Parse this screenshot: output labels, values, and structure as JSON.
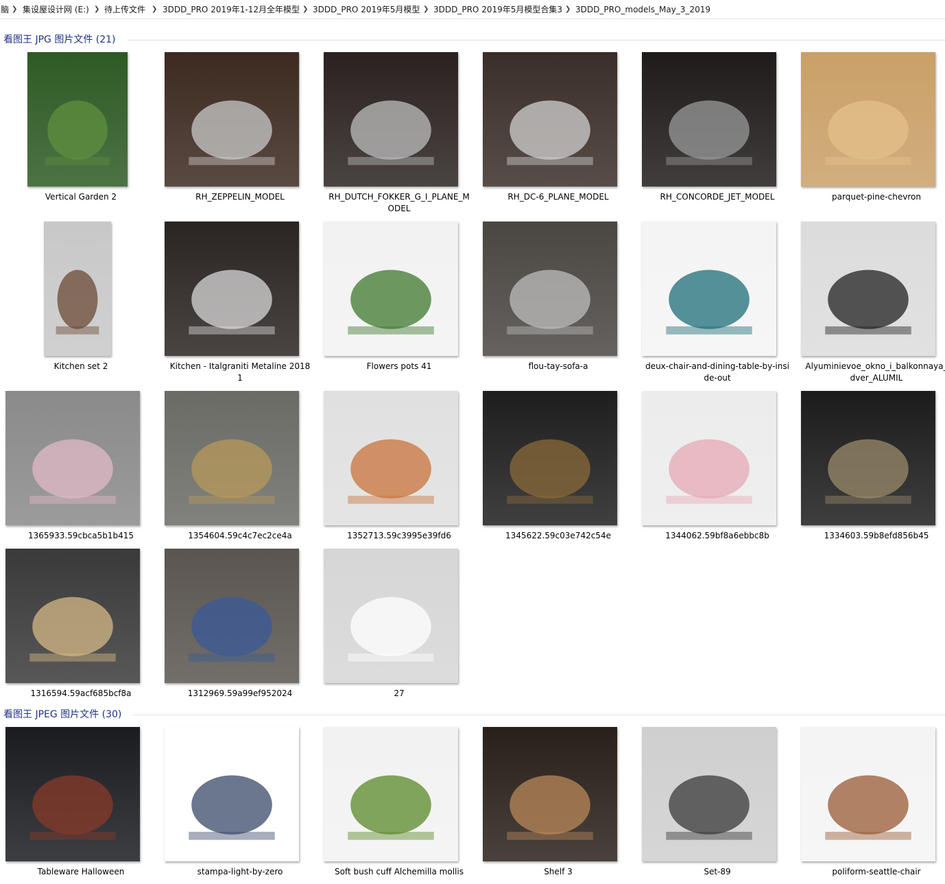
{
  "breadcrumb": [
    {
      "label": "脑"
    },
    {
      "label": "集设屋设计网 (E:)"
    },
    {
      "label": "待上传文件"
    },
    {
      "label": "3DDD_PRO 2019年1-12月全年模型"
    },
    {
      "label": "3DDD_PRO 2019年5月模型"
    },
    {
      "label": "3DDD_PRO 2019年5月模型合集3"
    },
    {
      "label": "3DDD_PRO_models_May_3_2019"
    }
  ],
  "groups": [
    {
      "title": "看图王 JPG 图片文件 (21)"
    },
    {
      "title": "看图王 JPEG 图片文件 (30)"
    }
  ],
  "files": [
    {
      "name": "Vertical Garden 2",
      "icon": "image-thumbnail-icon",
      "colors": [
        "#2e5a24",
        "#5f8f3f"
      ]
    },
    {
      "name": "RH_ZEPPELIN_MODEL",
      "icon": "image-thumbnail-icon",
      "colors": [
        "#3c2a20",
        "#c9c9c9"
      ]
    },
    {
      "name": "RH_DUTCH_FOKKER_G_I_PLANE_MODEL",
      "icon": "image-thumbnail-icon",
      "colors": [
        "#2a2220",
        "#bdbdbd"
      ]
    },
    {
      "name": "RH_DC-6_PLANE_MODEL",
      "icon": "image-thumbnail-icon",
      "colors": [
        "#3a2e28",
        "#d0d0d0"
      ]
    },
    {
      "name": "RH_CONCORDE_JET_MODEL",
      "icon": "image-thumbnail-icon",
      "colors": [
        "#1f1b1a",
        "#9a9a9a"
      ]
    },
    {
      "name": "parquet-pine-chevron",
      "icon": "image-thumbnail-icon",
      "colors": [
        "#c9a068",
        "#e3c08a"
      ]
    },
    {
      "name": "Kitchen set 2",
      "icon": "image-thumbnail-icon",
      "colors": [
        "#c8c8c8",
        "#6b4a35"
      ]
    },
    {
      "name": "Kitchen - Italgraniti Metaline 2018 1",
      "icon": "image-thumbnail-icon",
      "colors": [
        "#2a2422",
        "#d8d8d8"
      ]
    },
    {
      "name": "Flowers pots 41",
      "icon": "image-thumbnail-icon",
      "colors": [
        "#f2f2f2",
        "#3f7a2e"
      ]
    },
    {
      "name": "flou-tay-sofa-a",
      "icon": "image-thumbnail-icon",
      "colors": [
        "#4a4642",
        "#bdbdbd"
      ]
    },
    {
      "name": "deux-chair-and-dining-table-by-inside-out",
      "icon": "image-thumbnail-icon",
      "colors": [
        "#f4f4f4",
        "#1e6d78"
      ]
    },
    {
      "name": "Alyuminievoe_okno_i_balkonnaya_dver_ALUMIL",
      "icon": "image-thumbnail-icon",
      "colors": [
        "#dcdcdc",
        "#222222"
      ]
    },
    {
      "name": "1365933.59cbca5b1b415",
      "icon": "image-thumbnail-icon",
      "colors": [
        "#8a8a8a",
        "#e0b9c6"
      ]
    },
    {
      "name": "1354604.59c4c7ec2ce4a",
      "icon": "image-thumbnail-icon",
      "colors": [
        "#6b6b66",
        "#b89a5a"
      ]
    },
    {
      "name": "1352713.59c3995e39fd6",
      "icon": "image-thumbnail-icon",
      "colors": [
        "#e0e0e0",
        "#c9733a"
      ]
    },
    {
      "name": "1345622.59c03e742c54e",
      "icon": "image-thumbnail-icon",
      "colors": [
        "#1e1e1e",
        "#8a6a3a"
      ]
    },
    {
      "name": "1344062.59bf8a6ebbc8b",
      "icon": "image-thumbnail-icon",
      "colors": [
        "#ececec",
        "#e6a8b4"
      ]
    },
    {
      "name": "1334603.59b8efd856b45",
      "icon": "image-thumbnail-icon",
      "colors": [
        "#1c1c1c",
        "#9a8a6a"
      ]
    },
    {
      "name": "1316594.59acf685bcf8a",
      "icon": "image-thumbnail-icon",
      "colors": [
        "#3a3a3a",
        "#d6b886"
      ]
    },
    {
      "name": "1312969.59a99ef952024",
      "icon": "image-thumbnail-icon",
      "colors": [
        "#5a5550",
        "#3a5a9a"
      ]
    },
    {
      "name": "27",
      "icon": "image-thumbnail-icon",
      "colors": [
        "#d6d6d6",
        "#ffffff"
      ]
    },
    {
      "name": "Tableware Halloween",
      "icon": "image-thumbnail-icon",
      "colors": [
        "#1a1c20",
        "#8a3a2a"
      ]
    },
    {
      "name": "stampa-light-by-zero",
      "icon": "image-thumbnail-icon",
      "colors": [
        "#ffffff",
        "#3a4a6a"
      ]
    },
    {
      "name": "Soft bush cuff  Alchemilla mollis",
      "icon": "image-thumbnail-icon",
      "colors": [
        "#f2f2f2",
        "#5a8a2a"
      ]
    },
    {
      "name": "Shelf 3",
      "icon": "image-thumbnail-icon",
      "colors": [
        "#2a201a",
        "#b8885a"
      ]
    },
    {
      "name": "Set-89",
      "icon": "image-thumbnail-icon",
      "colors": [
        "#cfcfcf",
        "#3a3a3a"
      ]
    },
    {
      "name": "poliform-seattle-chair",
      "icon": "image-thumbnail-icon",
      "colors": [
        "#f4f4f4",
        "#9a5a36"
      ]
    }
  ]
}
